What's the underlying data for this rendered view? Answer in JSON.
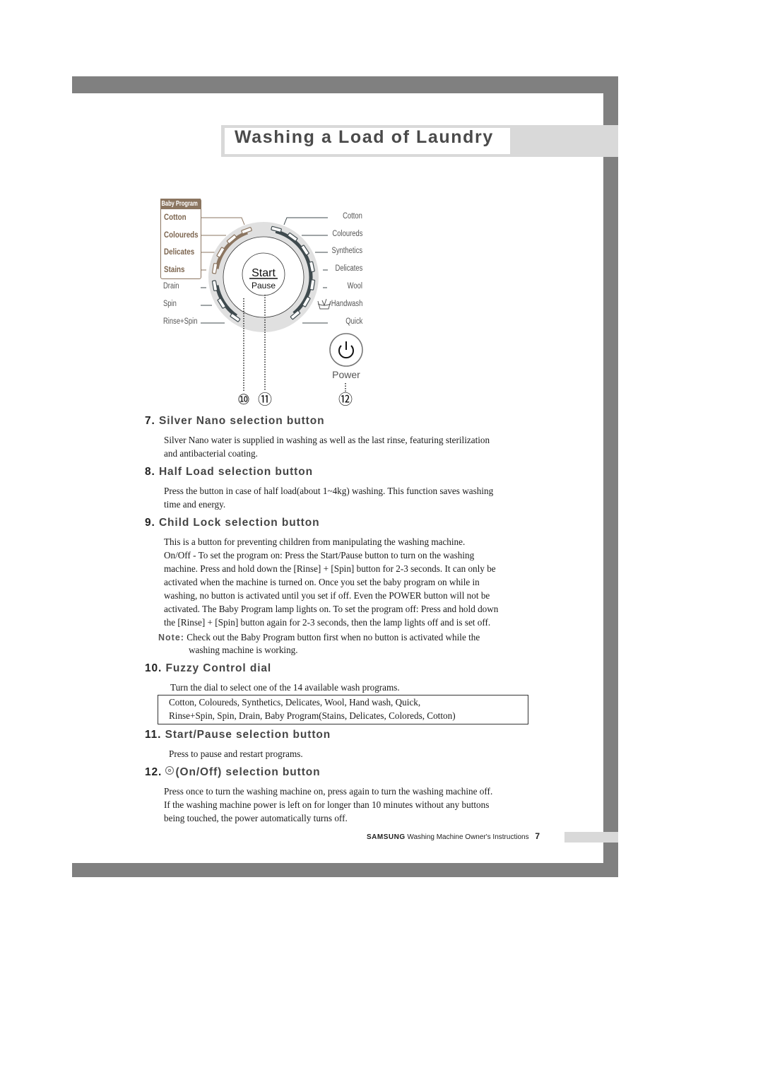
{
  "page": {
    "title": "Washing a Load of Laundry",
    "footer": {
      "brand": "SAMSUNG",
      "text": "Washing Machine Owner's Instructions",
      "page_number": "7"
    }
  },
  "diagram": {
    "baby_program": {
      "header": "Baby Program",
      "items": [
        "Cotton",
        "Coloureds",
        "Delicates",
        "Stains"
      ]
    },
    "left_programs": [
      "Drain",
      "Spin",
      "Rinse+Spin"
    ],
    "right_programs": [
      "Cotton",
      "Coloureds",
      "Synthetics",
      "Delicates",
      "Wool",
      "Handwash",
      "Quick"
    ],
    "start_label": "Start",
    "pause_label": "Pause",
    "power_label": "Power",
    "callouts": [
      "⑩",
      "⑪",
      "⑫"
    ],
    "icons": {
      "handwash": "handwash-tub-icon",
      "power": "power-icon"
    },
    "colors": {
      "baby_accent": "#8b7560",
      "dial_track": "#3f4a4e",
      "dial_ring": "#e0e0e0"
    }
  },
  "sections": [
    {
      "number": "7.",
      "title": "Silver Nano selection button",
      "lines": [
        "Silver Nano water is supplied in washing as well as the last rinse, featuring sterilization",
        "and antibacterial coating."
      ]
    },
    {
      "number": "8.",
      "title": "Half Load selection button",
      "lines": [
        "Press the button in case of half load(about 1~4kg) washing. This function saves washing",
        "time and energy."
      ]
    },
    {
      "number": "9.",
      "title": "Child Lock selection button",
      "lines": [
        "This is a button for preventing children from manipulating the washing machine.",
        "On/Off - To set the program on: Press the Start/Pause button to turn on the washing",
        "machine. Press and hold down the [Rinse] + [Spin] button for 2-3 seconds. It can only be",
        "activated when the machine is turned on. Once you set the baby program on while in",
        "washing, no button is activated until you set if off. Even the POWER button will not be",
        "activated. The Baby Program lamp lights on. To set the program off: Press and hold down",
        "the [Rinse] + [Spin] button again for 2-3 seconds, then the lamp lights off and is set off."
      ],
      "note_label": "Note:",
      "note_lines": [
        "Check out the Baby Program button first when no button is activated while the",
        "washing machine is working."
      ]
    },
    {
      "number": "10.",
      "title": "Fuzzy Control dial",
      "lines": [
        "Turn the dial to select one of the 14 available wash programs."
      ],
      "box_lines": [
        "Cotton, Coloureds, Synthetics, Delicates, Wool, Hand wash, Quick,",
        "Rinse+Spin, Spin, Drain, Baby Program(Stains, Delicates, Coloreds, Cotton)"
      ]
    },
    {
      "number": "11.",
      "title": "Start/Pause selection button",
      "lines": [
        "Press to pause and restart programs."
      ]
    },
    {
      "number": "12.",
      "title": "(On/Off) selection button",
      "lines": [
        "Press once to turn the washing machine on, press again to turn the washing machine off.",
        "If the washing machine power is left on for longer than 10 minutes without any buttons",
        "being touched, the power automatically turns off."
      ]
    }
  ]
}
